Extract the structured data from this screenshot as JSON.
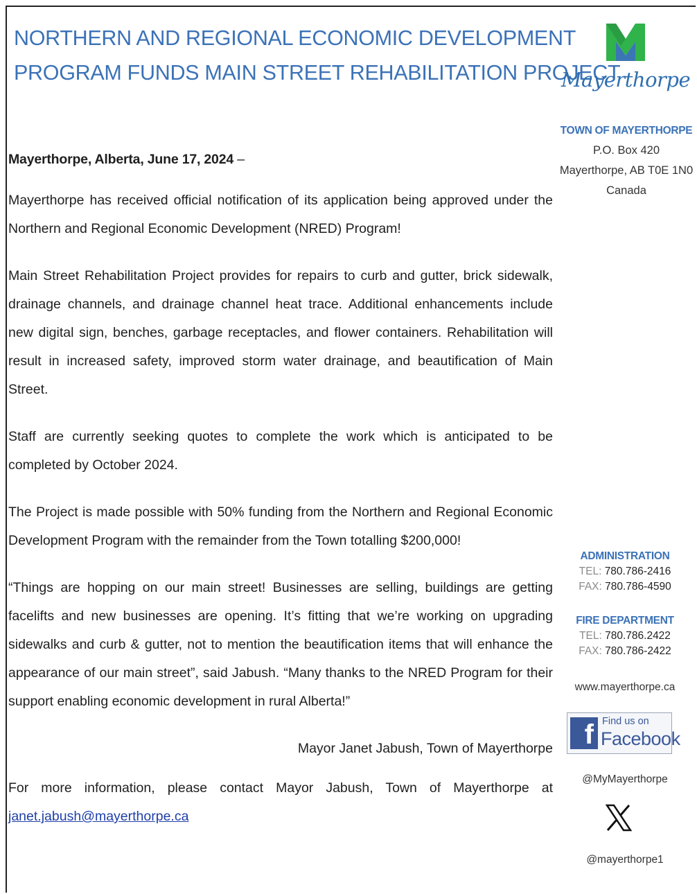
{
  "title": {
    "line1": "NORTHERN AND REGIONAL ECONOMIC DEVELOPMENT",
    "line2": "PROGRAM FUNDS MAIN STREET REHABILITATION PROJECT"
  },
  "logo": {
    "name": "Mayerthorpe",
    "icon": "mayerthorpe-m-logo",
    "colors": {
      "green": "#2fb34a",
      "blue": "#2f6fb0"
    }
  },
  "address": {
    "org": "TOWN OF MAYERTHORPE",
    "po_box": "P.O. Box 420",
    "city": "Mayerthorpe, AB T0E 1N0",
    "country": "Canada"
  },
  "dateline": "Mayerthorpe, Alberta, June 17, 2024",
  "dateline_suffix": " –",
  "paragraphs": [
    "Mayerthorpe has received official notification of its application being approved under the Northern and Regional Economic Development (NRED) Program!",
    "Main Street Rehabilitation Project provides for repairs to curb and gutter, brick sidewalk, drainage channels, and drainage channel heat trace.  Additional enhancements include new digital sign, benches, garbage receptacles, and flower containers.  Rehabilitation will result in increased safety, improved storm water drainage, and beautification of Main Street.",
    "Staff are currently seeking quotes to complete the work which is anticipated to be completed by October 2024.",
    "The Project is made possible with 50% funding from the Northern and Regional Economic Development Program with the remainder from the Town totalling $200,000!",
    "“Things are hopping on our main street! Businesses are selling, buildings are getting facelifts and new businesses are opening. It’s fitting that we’re working on upgrading sidewalks and curb & gutter, not to mention the beautification items that will enhance the appearance of our main street”, said Jabush. “Many thanks to the NRED Program for their support enabling economic development in rural Alberta!”"
  ],
  "signature": "Mayor Janet Jabush, Town of Mayerthorpe",
  "contact_text": "For more information, please contact Mayor Jabush, Town of Mayerthorpe at",
  "contact_email": "janet.jabush@mayerthorpe.ca",
  "sidebar": {
    "administration": {
      "label": "ADMINISTRATION",
      "tel_label": "TEL:",
      "tel": "780.786-2416",
      "fax_label": "FAX:",
      "fax": "780.786-4590"
    },
    "fire": {
      "label": "FIRE DEPARTMENT",
      "tel_label": "TEL:",
      "tel": "780.786.2422",
      "fax_label": "FAX:",
      "fax": "780.786-2422"
    },
    "website": "www.mayerthorpe.ca",
    "facebook": {
      "find": "Find us on",
      "word": "Facebook",
      "icon": "facebook-icon",
      "color": "#3b5998"
    },
    "facebook_handle": "@MyMayerthorpe",
    "x_icon": "x-logo-icon",
    "x_handle": "@mayerthorpe1"
  },
  "colors": {
    "title_blue": "#3b72b7",
    "link_blue": "#1f3fa8"
  }
}
